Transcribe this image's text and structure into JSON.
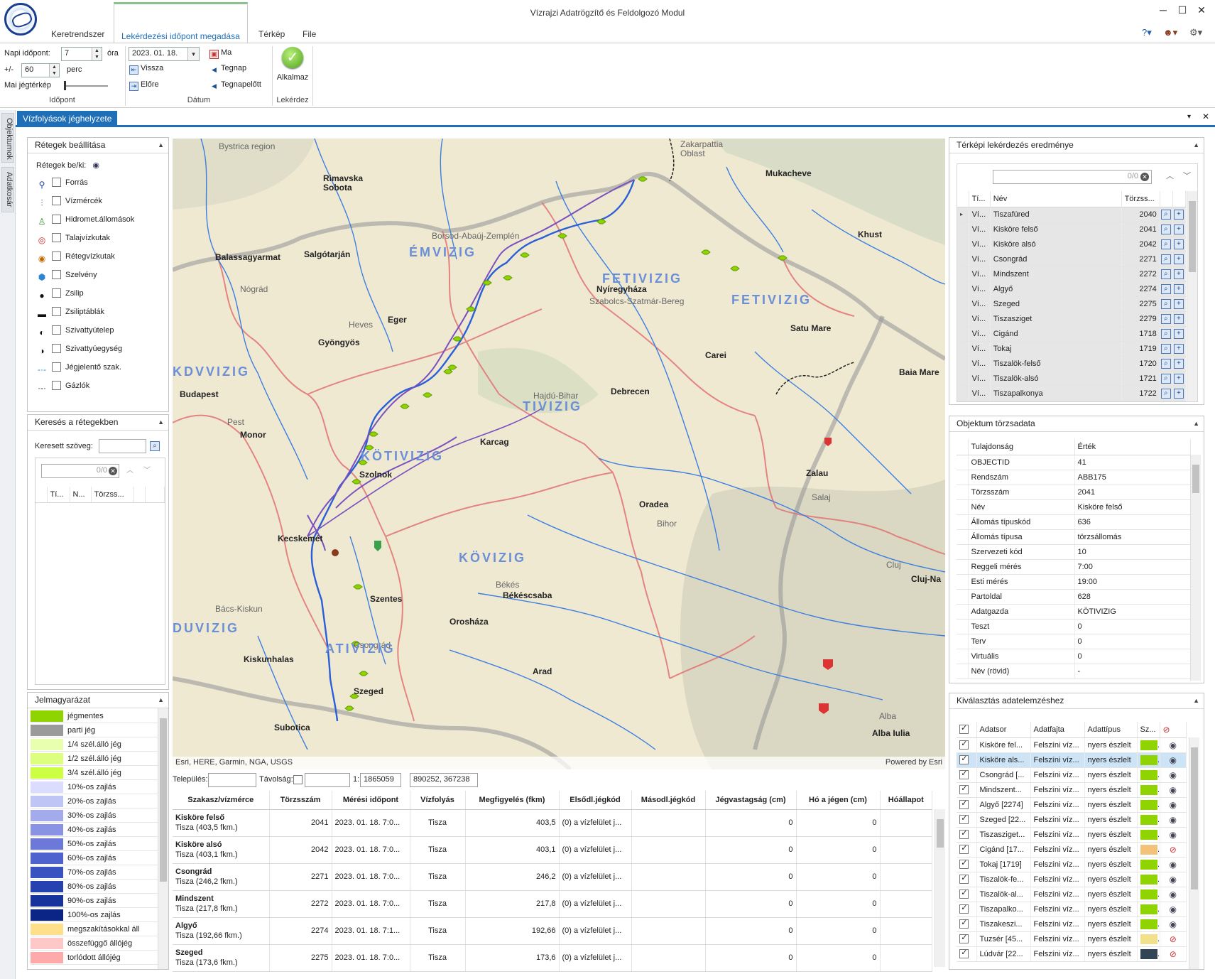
{
  "app_title": "Vízrajzi Adatrögzítő és Feldolgozó Modul",
  "ribbon_tabs": [
    {
      "label": "Keretrendszer",
      "active": false
    },
    {
      "label": "Lekérdezési időpont megadása",
      "active": true
    },
    {
      "label": "Térkép",
      "active": false
    },
    {
      "label": "File",
      "active": false
    }
  ],
  "ribbon": {
    "idopont": {
      "napi_label": "Napi időpont:",
      "napi_value": "7",
      "ora_label": "óra",
      "pm_label": "+/-",
      "pm_value": "60",
      "perc_label": "perc",
      "jeg_label": "Mai jégtérkép",
      "group_label": "Időpont"
    },
    "datum": {
      "date_value": "2023. 01. 18.",
      "vissza": "Vissza",
      "elore": "Előre",
      "ma": "Ma",
      "tegnap": "Tegnap",
      "tegnapelott": "Tegnapelőtt",
      "group_label": "Dátum"
    },
    "lekerdez": {
      "alkalmaz": "Alkalmaz",
      "group_label": "Lekérdez"
    }
  },
  "side_tabs": [
    "Objektumok",
    "Adatkosár"
  ],
  "doc_tab": "Vízfolyások jéghelyzete",
  "layers_panel": {
    "title": "Rétegek beállítása",
    "toggle_label": "Rétegek be/ki:",
    "items": [
      {
        "label": "Forrás",
        "icon": "magnifier-icon"
      },
      {
        "label": "Vízmércék",
        "icon": "gauge-icon"
      },
      {
        "label": "Hidromet.állomások",
        "icon": "station-icon"
      },
      {
        "label": "Talajvízkutak",
        "icon": "well-icon"
      },
      {
        "label": "Rétegvízkutak",
        "icon": "deep-well-icon"
      },
      {
        "label": "Szelvény",
        "icon": "section-icon"
      },
      {
        "label": "Zsilip",
        "icon": "sluice-icon"
      },
      {
        "label": "Zsiliptáblák",
        "icon": "sluice-gate-icon"
      },
      {
        "label": "Szivattyútelep",
        "icon": "pump-station-icon"
      },
      {
        "label": "Szivattyúegység",
        "icon": "pump-unit-icon"
      },
      {
        "label": "Jégjelentő szak.",
        "icon": "ice-report-icon"
      },
      {
        "label": "Gázlók",
        "icon": "ford-icon"
      }
    ]
  },
  "search_panel": {
    "title": "Keresés a rétegekben",
    "search_label": "Keresett szöveg:",
    "counter": "0/0",
    "columns": [
      "Tí...",
      "N...",
      "Törzss..."
    ]
  },
  "legend_panel": {
    "title": "Jelmagyarázat",
    "items": [
      {
        "label": "jégmentes",
        "color": "#8fd400"
      },
      {
        "label": "parti jég",
        "color": "#9a9a9a"
      },
      {
        "label": "1/4 szél.álló jég",
        "color": "#e8ffb0"
      },
      {
        "label": "1/2 szél.álló jég",
        "color": "#dcff80"
      },
      {
        "label": "3/4 szél.álló jég",
        "color": "#ccff44"
      },
      {
        "label": "10%-os zajlás",
        "color": "#dcdcff"
      },
      {
        "label": "20%-os zajlás",
        "color": "#bfc5f5"
      },
      {
        "label": "30%-os zajlás",
        "color": "#a3abec"
      },
      {
        "label": "40%-os zajlás",
        "color": "#8a92e4"
      },
      {
        "label": "50%-os zajlás",
        "color": "#6c79d9"
      },
      {
        "label": "60%-os zajlás",
        "color": "#4f63cf"
      },
      {
        "label": "70%-os zajlás",
        "color": "#3952c2"
      },
      {
        "label": "80%-os zajlás",
        "color": "#2542b0"
      },
      {
        "label": "90%-os zajlás",
        "color": "#17339c"
      },
      {
        "label": "100%-os zajlás",
        "color": "#0a2585"
      },
      {
        "label": "megszakításokkal áll",
        "color": "#ffe08a"
      },
      {
        "label": "összefüggő állójég",
        "color": "#ffc8c8"
      },
      {
        "label": "torlódott állójég",
        "color": "#ffaaaa"
      }
    ]
  },
  "map": {
    "attribution": "Esri, HERE, Garmin, NGA, USGS",
    "powered": "Powered by Esri",
    "labels": [
      {
        "t": "Rimavska Sobota",
        "k": "city"
      },
      {
        "t": "Mukacheve",
        "k": "city"
      },
      {
        "t": "Zakarpattia Oblast",
        "k": "region"
      },
      {
        "t": "Bystrica region",
        "k": "region"
      },
      {
        "t": "Salgótarján",
        "k": "city"
      },
      {
        "t": "Balassagyarmat",
        "k": "city"
      },
      {
        "t": "Borsod-Abaúj-Zemplén",
        "k": "region"
      },
      {
        "t": "Nógrád",
        "k": "region"
      },
      {
        "t": "Heves",
        "k": "region"
      },
      {
        "t": "Eger",
        "k": "city"
      },
      {
        "t": "Gyöngyös",
        "k": "city"
      },
      {
        "t": "Nyíregyháza",
        "k": "city"
      },
      {
        "t": "Szabolcs-Szatmár-Bereg",
        "k": "region"
      },
      {
        "t": "Khust",
        "k": "city"
      },
      {
        "t": "Satu Mare",
        "k": "city"
      },
      {
        "t": "Carei",
        "k": "city"
      },
      {
        "t": "Baia Mare",
        "k": "city"
      },
      {
        "t": "Budapest",
        "k": "city"
      },
      {
        "t": "Pest",
        "k": "region"
      },
      {
        "t": "Monor",
        "k": "city"
      },
      {
        "t": "Debrecen",
        "k": "city"
      },
      {
        "t": "Hajdú-Bihar",
        "k": "region"
      },
      {
        "t": "Karcag",
        "k": "city"
      },
      {
        "t": "Szolnok",
        "k": "city"
      },
      {
        "t": "Zalau",
        "k": "city"
      },
      {
        "t": "Salaj",
        "k": "region"
      },
      {
        "t": "Oradea",
        "k": "city"
      },
      {
        "t": "Bihor",
        "k": "region"
      },
      {
        "t": "Kecskemét",
        "k": "city"
      },
      {
        "t": "Szentes",
        "k": "city"
      },
      {
        "t": "Békéscsaba",
        "k": "city"
      },
      {
        "t": "Békés",
        "k": "region"
      },
      {
        "t": "Orosháza",
        "k": "city"
      },
      {
        "t": "Cluj-Na",
        "k": "city"
      },
      {
        "t": "Cluj",
        "k": "region"
      },
      {
        "t": "Bács-Kiskun",
        "k": "region"
      },
      {
        "t": "Kiskunhalas",
        "k": "city"
      },
      {
        "t": "Szeged",
        "k": "city"
      },
      {
        "t": "Csongrád",
        "k": "region"
      },
      {
        "t": "Subotica",
        "k": "city"
      },
      {
        "t": "Arad",
        "k": "city"
      },
      {
        "t": "Alba",
        "k": "region"
      },
      {
        "t": "Alba Iulia",
        "k": "city"
      },
      {
        "t": "ÉMVIZIG",
        "k": "dir"
      },
      {
        "t": "FETIVIZIG",
        "k": "dir"
      },
      {
        "t": "FETIVIZIG",
        "k": "dir"
      },
      {
        "t": "KDVVIZIG",
        "k": "dir"
      },
      {
        "t": "TIVIZIG",
        "k": "dir"
      },
      {
        "t": "KÖTIVIZIG",
        "k": "dir"
      },
      {
        "t": "KÖVIZIG",
        "k": "dir"
      },
      {
        "t": "ATIVIZIG",
        "k": "dir"
      },
      {
        "t": "DUVIZIG",
        "k": "dir"
      }
    ]
  },
  "map_tools": {
    "telepules": "Település:",
    "tavolsag": "Távolság:",
    "scale_label": "1:",
    "scale_value": "1865059",
    "coords": "890252, 367238"
  },
  "results": {
    "columns": [
      "Szakasz/vízmérce",
      "Törzsszám",
      "Mérési időpont",
      "Vízfolyás",
      "Megfigyelés (fkm)",
      "Elsődl.jégkód",
      "Másodl.jégkód",
      "Jégvastagság (cm)",
      "Hó a jégen (cm)",
      "Hóállapot"
    ],
    "rows": [
      {
        "name": "Kisköre felső",
        "sub": "Tisza (403,5 fkm.)",
        "torzs": "2041",
        "ido": "2023. 01. 18. 7:0...",
        "viz": "Tisza",
        "fkm": "403,5",
        "elso": "(0) a vízfelület j...",
        "maso": "",
        "vast": "0",
        "ho": "0",
        "hoall": ""
      },
      {
        "name": "Kisköre alsó",
        "sub": "Tisza (403,1 fkm.)",
        "torzs": "2042",
        "ido": "2023. 01. 18. 7:0...",
        "viz": "Tisza",
        "fkm": "403,1",
        "elso": "(0) a vízfelület j...",
        "maso": "",
        "vast": "0",
        "ho": "0",
        "hoall": ""
      },
      {
        "name": "Csongrád",
        "sub": "Tisza (246,2 fkm.)",
        "torzs": "2271",
        "ido": "2023. 01. 18. 7:0...",
        "viz": "Tisza",
        "fkm": "246,2",
        "elso": "(0) a vízfelület j...",
        "maso": "",
        "vast": "0",
        "ho": "0",
        "hoall": ""
      },
      {
        "name": "Mindszent",
        "sub": "Tisza (217,8 fkm.)",
        "torzs": "2272",
        "ido": "2023. 01. 18. 7:0...",
        "viz": "Tisza",
        "fkm": "217,8",
        "elso": "(0) a vízfelület j...",
        "maso": "",
        "vast": "0",
        "ho": "0",
        "hoall": ""
      },
      {
        "name": "Algyő",
        "sub": "Tisza (192,66 fkm.)",
        "torzs": "2274",
        "ido": "2023. 01. 18. 7:1...",
        "viz": "Tisza",
        "fkm": "192,66",
        "elso": "(0) a vízfelület j...",
        "maso": "",
        "vast": "0",
        "ho": "0",
        "hoall": ""
      },
      {
        "name": "Szeged",
        "sub": "Tisza (173,6 fkm.)",
        "torzs": "2275",
        "ido": "2023. 01. 18. 7:0...",
        "viz": "Tisza",
        "fkm": "173,6",
        "elso": "(0) a vízfelület j...",
        "maso": "",
        "vast": "0",
        "ho": "0",
        "hoall": ""
      }
    ]
  },
  "query_panel": {
    "title": "Térképi lekérdezés eredménye",
    "counter": "0/0",
    "columns": [
      "Tí...",
      "Név",
      "Törzss..."
    ],
    "rows": [
      {
        "t": "Ví...",
        "n": "Tiszafüred",
        "z": "2040"
      },
      {
        "t": "Ví...",
        "n": "Kisköre felső",
        "z": "2041"
      },
      {
        "t": "Ví...",
        "n": "Kisköre alsó",
        "z": "2042"
      },
      {
        "t": "Ví...",
        "n": "Csongrád",
        "z": "2271"
      },
      {
        "t": "Ví...",
        "n": "Mindszent",
        "z": "2272"
      },
      {
        "t": "Ví...",
        "n": "Algyő",
        "z": "2274"
      },
      {
        "t": "Ví...",
        "n": "Szeged",
        "z": "2275"
      },
      {
        "t": "Ví...",
        "n": "Tiszasziget",
        "z": "2279"
      },
      {
        "t": "Ví...",
        "n": "Cigánd",
        "z": "1718"
      },
      {
        "t": "Ví...",
        "n": "Tokaj",
        "z": "1719"
      },
      {
        "t": "Ví...",
        "n": "Tiszalök-felső",
        "z": "1720"
      },
      {
        "t": "Ví...",
        "n": "Tiszalök-alsó",
        "z": "1721"
      },
      {
        "t": "Ví...",
        "n": "Tiszapalkonya",
        "z": "1722"
      }
    ]
  },
  "object_panel": {
    "title": "Objektum törzsadata",
    "col_prop": "Tulajdonság",
    "col_val": "Érték",
    "rows": [
      {
        "k": "OBJECTID",
        "v": "41"
      },
      {
        "k": "Rendszám",
        "v": "ABB175"
      },
      {
        "k": "Törzsszám",
        "v": "2041"
      },
      {
        "k": "Név",
        "v": "Kisköre felső"
      },
      {
        "k": "Állomás típuskód",
        "v": "636"
      },
      {
        "k": "Állomás típusa",
        "v": "törzsállomás"
      },
      {
        "k": "Szervezeti kód",
        "v": "10"
      },
      {
        "k": "Reggeli mérés",
        "v": "7:00"
      },
      {
        "k": "Esti mérés",
        "v": "19:00"
      },
      {
        "k": "Partoldal",
        "v": "628"
      },
      {
        "k": "Adatgazda",
        "v": "KÖTIVIZIG"
      },
      {
        "k": "Teszt",
        "v": "0"
      },
      {
        "k": "Terv",
        "v": "0"
      },
      {
        "k": "Virtuális",
        "v": "0"
      },
      {
        "k": "Név (rövid)",
        "v": "-"
      }
    ]
  },
  "selection_panel": {
    "title": "Kiválasztás adatelemzéshez",
    "columns": [
      "Adatsor",
      "Adatfajta",
      "Adattípus",
      "Sz..."
    ],
    "rows": [
      {
        "a": "Kisköre fel...",
        "f": "Felszíni víz...",
        "t": "nyers észlelt",
        "c": "#8fd400",
        "vis": true
      },
      {
        "a": "Kisköre als...",
        "f": "Felszíni víz...",
        "t": "nyers észlelt",
        "c": "#8fd400",
        "vis": true
      },
      {
        "a": "Csongrád [...",
        "f": "Felszíni víz...",
        "t": "nyers észlelt",
        "c": "#8fd400",
        "vis": true
      },
      {
        "a": "Mindszent...",
        "f": "Felszíni víz...",
        "t": "nyers észlelt",
        "c": "#8fd400",
        "vis": true
      },
      {
        "a": "Algyő [2274]",
        "f": "Felszíni víz...",
        "t": "nyers észlelt",
        "c": "#8fd400",
        "vis": true
      },
      {
        "a": "Szeged [22...",
        "f": "Felszíni víz...",
        "t": "nyers észlelt",
        "c": "#8fd400",
        "vis": true
      },
      {
        "a": "Tiszasziget...",
        "f": "Felszíni víz...",
        "t": "nyers észlelt",
        "c": "#8fd400",
        "vis": true
      },
      {
        "a": "Cigánd [17...",
        "f": "Felszíni víz...",
        "t": "nyers észlelt",
        "c": "#f2c27a",
        "vis": false
      },
      {
        "a": "Tokaj [1719]",
        "f": "Felszíni víz...",
        "t": "nyers észlelt",
        "c": "#8fd400",
        "vis": true
      },
      {
        "a": "Tiszalök-fe...",
        "f": "Felszíni víz...",
        "t": "nyers észlelt",
        "c": "#8fd400",
        "vis": true
      },
      {
        "a": "Tiszalök-al...",
        "f": "Felszíni víz...",
        "t": "nyers észlelt",
        "c": "#8fd400",
        "vis": true
      },
      {
        "a": "Tiszapalko...",
        "f": "Felszíni víz...",
        "t": "nyers észlelt",
        "c": "#8fd400",
        "vis": true
      },
      {
        "a": "Tiszakeszi...",
        "f": "Felszíni víz...",
        "t": "nyers észlelt",
        "c": "#8fd400",
        "vis": true
      },
      {
        "a": "Tuzsér [45...",
        "f": "Felszíni víz...",
        "t": "nyers észlelt",
        "c": "#f2e08a",
        "vis": false
      },
      {
        "a": "Lúdvár [22...",
        "f": "Felszíni víz...",
        "t": "nyers észlelt",
        "c": "#334455",
        "vis": false
      }
    ]
  },
  "colors": {
    "accent": "#1e6fb8",
    "selected_row": "#cde4f7",
    "query_row": "#e6e6e6"
  }
}
